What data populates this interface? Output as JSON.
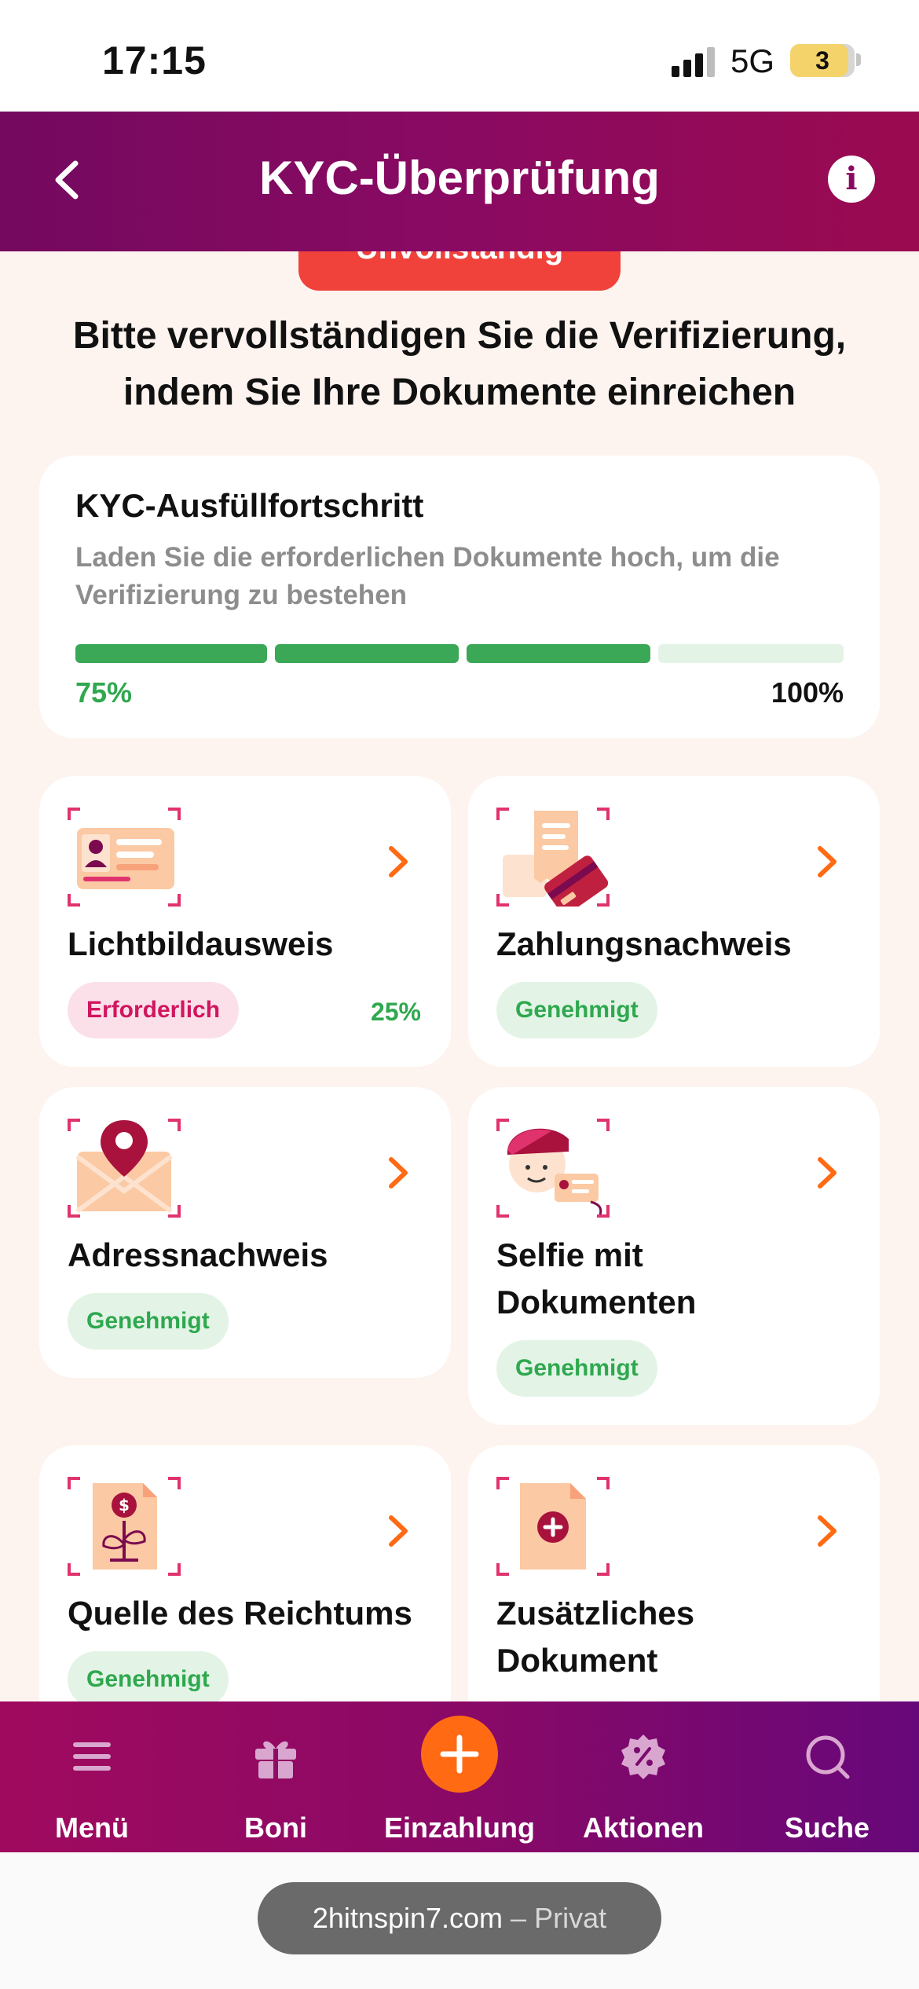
{
  "status_bar": {
    "time": "17:15",
    "network": "5G",
    "battery": "3",
    "icons": [
      "signal-icon",
      "battery-icon"
    ]
  },
  "header": {
    "title": "KYC-Überprüfung",
    "back_icon": "chevron-left-icon",
    "info_icon": "info-icon",
    "info_glyph": "i"
  },
  "status_pill": {
    "label": "Unvollständig",
    "icon": "upload-icon",
    "color": "#f0423a"
  },
  "intro": "Bitte vervollständigen Sie die Verifizierung, indem Sie Ihre Dokumente einreichen",
  "progress": {
    "title": "KYC-Ausfüllfortschritt",
    "description": "Laden Sie die erforderlichen Dokumente hoch, um die Verifizierung zu bestehen",
    "value": 0.75,
    "segments_total": 4,
    "segments_filled": 3,
    "current_label": "75%",
    "max_label": "100%",
    "fill_color": "#3aa856",
    "empty_color": "#e3f4e6"
  },
  "documents": [
    {
      "title": "Lichtbildausweis",
      "icon": "id-card-icon",
      "status": "Erforderlich",
      "status_type": "required",
      "progress": "25%"
    },
    {
      "title": "Zahlungsnachweis",
      "icon": "payment-receipt-icon",
      "status": "Genehmigt",
      "status_type": "approved"
    },
    {
      "title": "Adressnachweis",
      "icon": "location-envelope-icon",
      "status": "Genehmigt",
      "status_type": "approved"
    },
    {
      "title": "Selfie mit Dokumenten",
      "icon": "selfie-document-icon",
      "status": "Genehmigt",
      "status_type": "approved"
    },
    {
      "title": "Quelle des Reichtums",
      "icon": "wealth-plant-icon",
      "status": "Genehmigt",
      "status_type": "approved"
    },
    {
      "title": "Zusätzliches Dokument",
      "icon": "add-document-icon"
    }
  ],
  "bottom_nav": [
    {
      "label": "Menü",
      "icon": "menu-icon"
    },
    {
      "label": "Boni",
      "icon": "gift-icon"
    },
    {
      "label": "Einzahlung",
      "icon": "plus-icon"
    },
    {
      "label": "Aktionen",
      "icon": "discount-badge-icon"
    },
    {
      "label": "Suche",
      "icon": "search-icon"
    }
  ],
  "browser": {
    "domain": "2hitnspin7.com",
    "separator": "–",
    "mode": "Privat"
  },
  "colors": {
    "header_start": "#74095f",
    "header_end": "#9a0a50",
    "accent_orange": "#ff6a13",
    "approved_green": "#2fa84f",
    "required_pink": "#d0165f"
  }
}
